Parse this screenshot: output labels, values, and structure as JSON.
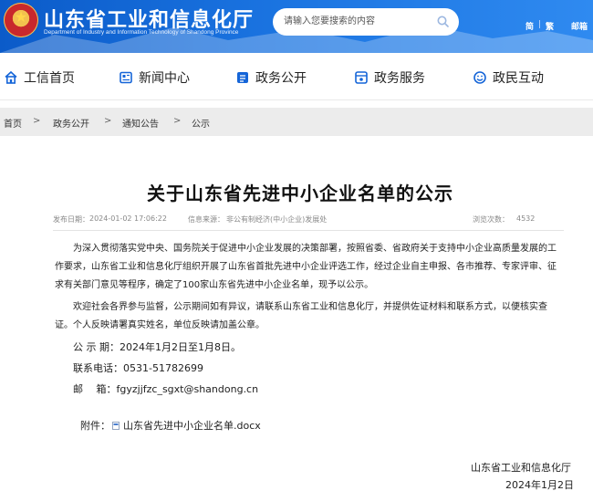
{
  "header": {
    "site_title": "山东省工业和信息化厅",
    "site_subtitle": "Department of Industry and Information Technology of Shandong Province",
    "search_placeholder": "请输入您要搜索的内容",
    "lang_simplified": "简",
    "lang_separator": "|",
    "lang_traditional": "繁",
    "mail_link": "邮箱"
  },
  "nav": {
    "items": [
      {
        "label": "工信首页",
        "icon": "home-icon"
      },
      {
        "label": "新闻中心",
        "icon": "news-icon"
      },
      {
        "label": "政务公开",
        "icon": "open-government-icon"
      },
      {
        "label": "政务服务",
        "icon": "service-icon"
      },
      {
        "label": "政民互动",
        "icon": "interaction-icon"
      }
    ]
  },
  "breadcrumb": {
    "items": [
      "首页",
      "政务公开",
      "通知公告",
      "公示"
    ],
    "separator": ">"
  },
  "article": {
    "title": "关于山东省先进中小企业名单的公示",
    "publish_label": "发布日期：",
    "publish_date": "2024-01-02 17:06:22",
    "source_label": "信息来源：",
    "source": "非公有制经济(中小企业)发展处",
    "views_label": "浏览次数：",
    "views": "4532",
    "paragraph1": "为深入贯彻落实党中央、国务院关于促进中小企业发展的决策部署，按照省委、省政府关于支持中小企业高质量发展的工作要求，山东省工业和信息化厅组织开展了山东省首批先进中小企业评选工作，经过企业自主申报、各市推荐、专家评审、征求有关部门意见等程序，确定了100家山东省先进中小企业名单，现予以公示。",
    "paragraph2": "欢迎社会各界参与监督，公示期间如有异议，请联系山东省工业和信息化厅，并提供佐证材料和联系方式，以便核实查证。个人反映请署真实姓名，单位反映请加盖公章。",
    "period_label": "公 示 期：",
    "period": "2024年1月2日至1月8日。",
    "phone_label": "联系电话：",
    "phone": "0531-51782699",
    "email_label": "邮　 箱：",
    "email": "fgyzjjfzc_sgxt@shandong.cn",
    "attachment_label": "附件：",
    "attachment_name": "山东省先进中小企业名单.docx",
    "signature_org": "山东省工业和信息化厅",
    "signature_date": "2024年1月2日"
  },
  "colors": {
    "header_blue": "#1a73e0",
    "nav_icon_blue": "#1565d8",
    "breadcrumb_bg": "#ececec"
  }
}
